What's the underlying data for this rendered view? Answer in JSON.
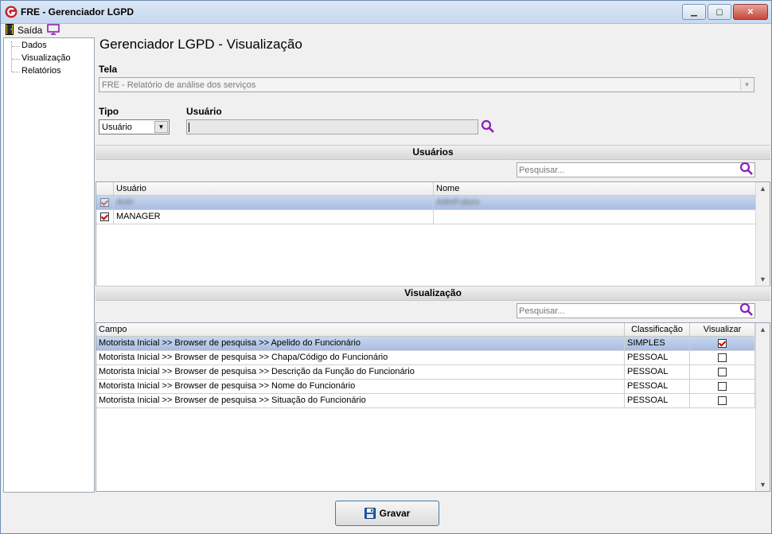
{
  "window": {
    "title": "FRE - Gerenciador LGPD",
    "minimize": "▁",
    "maximize": "▢",
    "close": "✕"
  },
  "menu": {
    "exit_label": "Saída"
  },
  "tree": {
    "items": [
      {
        "label": "Dados"
      },
      {
        "label": "Visualização"
      },
      {
        "label": "Relatórios"
      }
    ]
  },
  "page_title": "Gerenciador LGPD - Visualização",
  "tela": {
    "label": "Tela",
    "value": "FRE - Relatório de análise dos serviços"
  },
  "tipo": {
    "label": "Tipo",
    "value": "Usuário"
  },
  "usuario": {
    "label": "Usuário",
    "value": ""
  },
  "users_section": {
    "title": "Usuários",
    "search_placeholder": "Pesquisar...",
    "columns": [
      "Usuário",
      "Nome"
    ],
    "rows": [
      {
        "usuario": "Anin",
        "nome": "AdmFuturo",
        "checked": true,
        "selected": true,
        "blurred": true
      },
      {
        "usuario": "MANAGER",
        "nome": "",
        "checked": true,
        "selected": false,
        "blurred": false
      }
    ]
  },
  "view_section": {
    "title": "Visualização",
    "search_placeholder": "Pesquisar...",
    "columns": [
      "Campo",
      "Classificação",
      "Visualizar"
    ],
    "rows": [
      {
        "campo": "Motorista Inicial >> Browser de pesquisa >> Apelido do Funcionário",
        "classificacao": "SIMPLES",
        "visualizar": true,
        "selected": true
      },
      {
        "campo": "Motorista Inicial >> Browser de pesquisa >> Chapa/Código do Funcionário",
        "classificacao": "PESSOAL",
        "visualizar": false,
        "selected": false
      },
      {
        "campo": "Motorista Inicial >> Browser de pesquisa >> Descrição da Função do Funcionário",
        "classificacao": "PESSOAL",
        "visualizar": false,
        "selected": false
      },
      {
        "campo": "Motorista Inicial >> Browser de pesquisa >> Nome do Funcionário",
        "classificacao": "PESSOAL",
        "visualizar": false,
        "selected": false
      },
      {
        "campo": "Motorista Inicial >> Browser de pesquisa >> Situação do Funcionário",
        "classificacao": "PESSOAL",
        "visualizar": false,
        "selected": false
      }
    ]
  },
  "save_button": {
    "label": "Gravar"
  },
  "colors": {
    "accent_icon": "#8b1fb8",
    "selection": "#b7c9e8",
    "check": "#cc0000"
  }
}
